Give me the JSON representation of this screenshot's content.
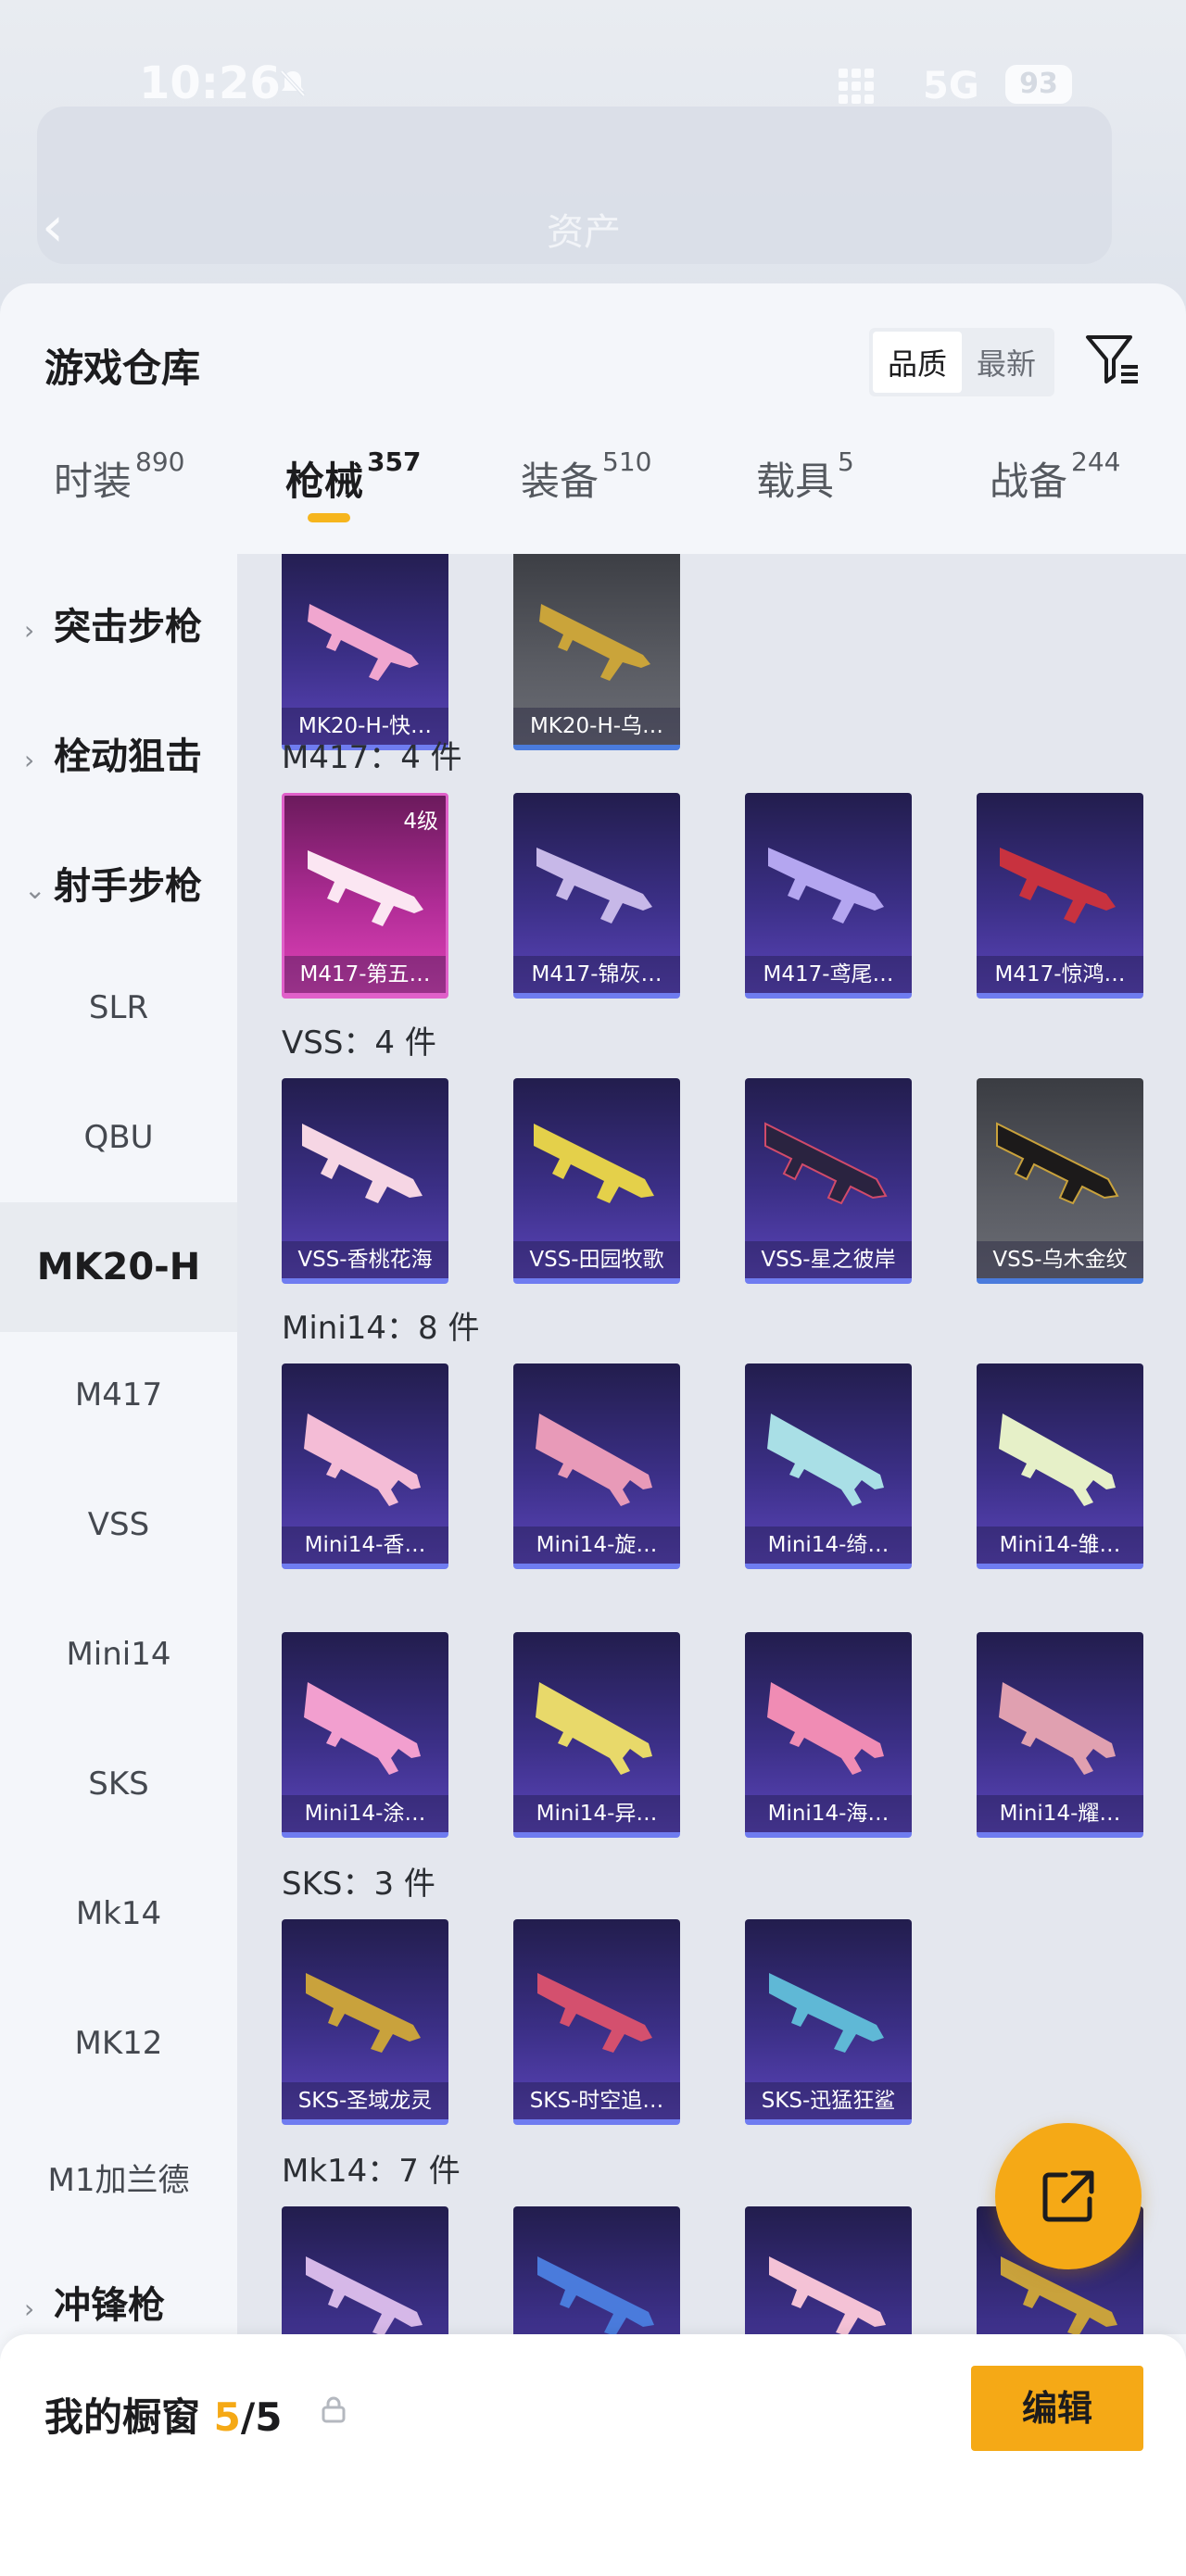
{
  "statusbar": {
    "time": "10:26",
    "network": "5G",
    "battery": "93"
  },
  "background": {
    "tab_hint": "资产"
  },
  "header": {
    "title": "游戏仓库",
    "sort_options": [
      "品质",
      "最新"
    ]
  },
  "tabs": [
    {
      "label": "时装",
      "count": "890"
    },
    {
      "label": "枪械",
      "count": "357"
    },
    {
      "label": "装备",
      "count": "510"
    },
    {
      "label": "载具",
      "count": "5"
    },
    {
      "label": "战备",
      "count": "244"
    }
  ],
  "sidebar": {
    "cat_assault": "突击步枪",
    "cat_bolt": "栓动狙击",
    "cat_marksman": "射手步枪",
    "sub": [
      "SLR",
      "QBU",
      "MK20-H",
      "M417",
      "VSS",
      "Mini14",
      "SKS",
      "Mk14",
      "MK12",
      "M1加兰德"
    ],
    "cat_smg": "冲锋枪"
  },
  "groups": {
    "mk20": {
      "items": [
        "MK20-H-快…",
        "MK20-H-乌…"
      ]
    },
    "m417": {
      "header": "M417：4 件",
      "level": "4级",
      "items": [
        "M417-第五…",
        "M417-锦灰…",
        "M417-鸢尾…",
        "M417-惊鸿…"
      ]
    },
    "vss": {
      "header": "VSS：4 件",
      "items": [
        "VSS-香桃花海",
        "VSS-田园牧歌",
        "VSS-星之彼岸",
        "VSS-乌木金纹"
      ]
    },
    "mini14": {
      "header": "Mini14：8 件",
      "items": [
        "Mini14-香…",
        "Mini14-旋…",
        "Mini14-绮…",
        "Mini14-雏…",
        "Mini14-涂…",
        "Mini14-异…",
        "Mini14-海…",
        "Mini14-耀…"
      ]
    },
    "sks": {
      "header": "SKS：3 件",
      "items": [
        "SKS-圣域龙灵",
        "SKS-时空追…",
        "SKS-迅猛狂鲨"
      ]
    },
    "mk14": {
      "header": "Mk14：7 件"
    }
  },
  "showcase": {
    "title": "我的橱窗",
    "current": "5",
    "total": "/5",
    "edit_label": "编辑"
  },
  "colors": {
    "accent": "#f5a916",
    "card_purple": "#3b2f86",
    "card_pink": "#b02c96"
  }
}
